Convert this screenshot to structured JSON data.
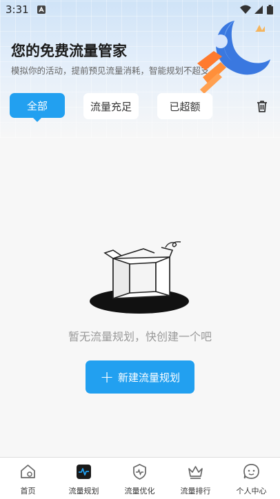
{
  "status_bar": {
    "time": "3:31"
  },
  "header": {
    "title": "您的免费流量管家",
    "subtitle": "模拟你的活动，提前预见流量消耗，智能规划不超支"
  },
  "filters": [
    {
      "label": "全部",
      "active": true
    },
    {
      "label": "流量充足",
      "active": false
    },
    {
      "label": "已超额",
      "active": false
    }
  ],
  "empty_state": {
    "message": "暂无流量规划，快创建一个吧",
    "button_label": "新建流量规划"
  },
  "tabbar": {
    "items": [
      {
        "label": "首页",
        "icon": "home-icon"
      },
      {
        "label": "流量规划",
        "icon": "traffic-plan-icon",
        "active": true
      },
      {
        "label": "流量优化",
        "icon": "shield-pulse-icon"
      },
      {
        "label": "流量排行",
        "icon": "crown-icon"
      },
      {
        "label": "个人中心",
        "icon": "face-icon"
      }
    ]
  },
  "colors": {
    "accent": "#22a0f0",
    "background": "#f7f7f7"
  }
}
